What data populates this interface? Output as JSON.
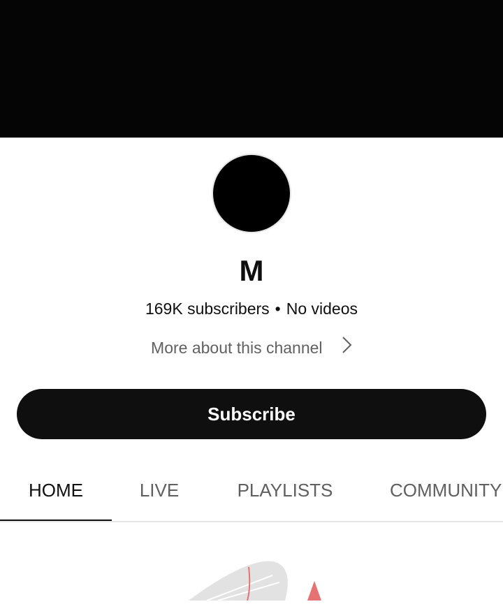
{
  "channel": {
    "name": "M",
    "subscribers": "169K subscribers",
    "separator": "•",
    "videos": "No videos",
    "more_about": "More about this channel"
  },
  "subscribe_label": "Subscribe",
  "tabs": [
    {
      "label": "HOME",
      "active": true
    },
    {
      "label": "LIVE",
      "active": false
    },
    {
      "label": "PLAYLISTS",
      "active": false
    },
    {
      "label": "COMMUNITY",
      "active": false
    }
  ],
  "colors": {
    "banner": "#050505",
    "avatar": "#000000",
    "subscribe_bg": "#0f0f0f",
    "muted_text": "#606060",
    "illustration_accent": "#e57373"
  },
  "icons": {
    "more_about_chevron": "chevron-right-icon"
  }
}
